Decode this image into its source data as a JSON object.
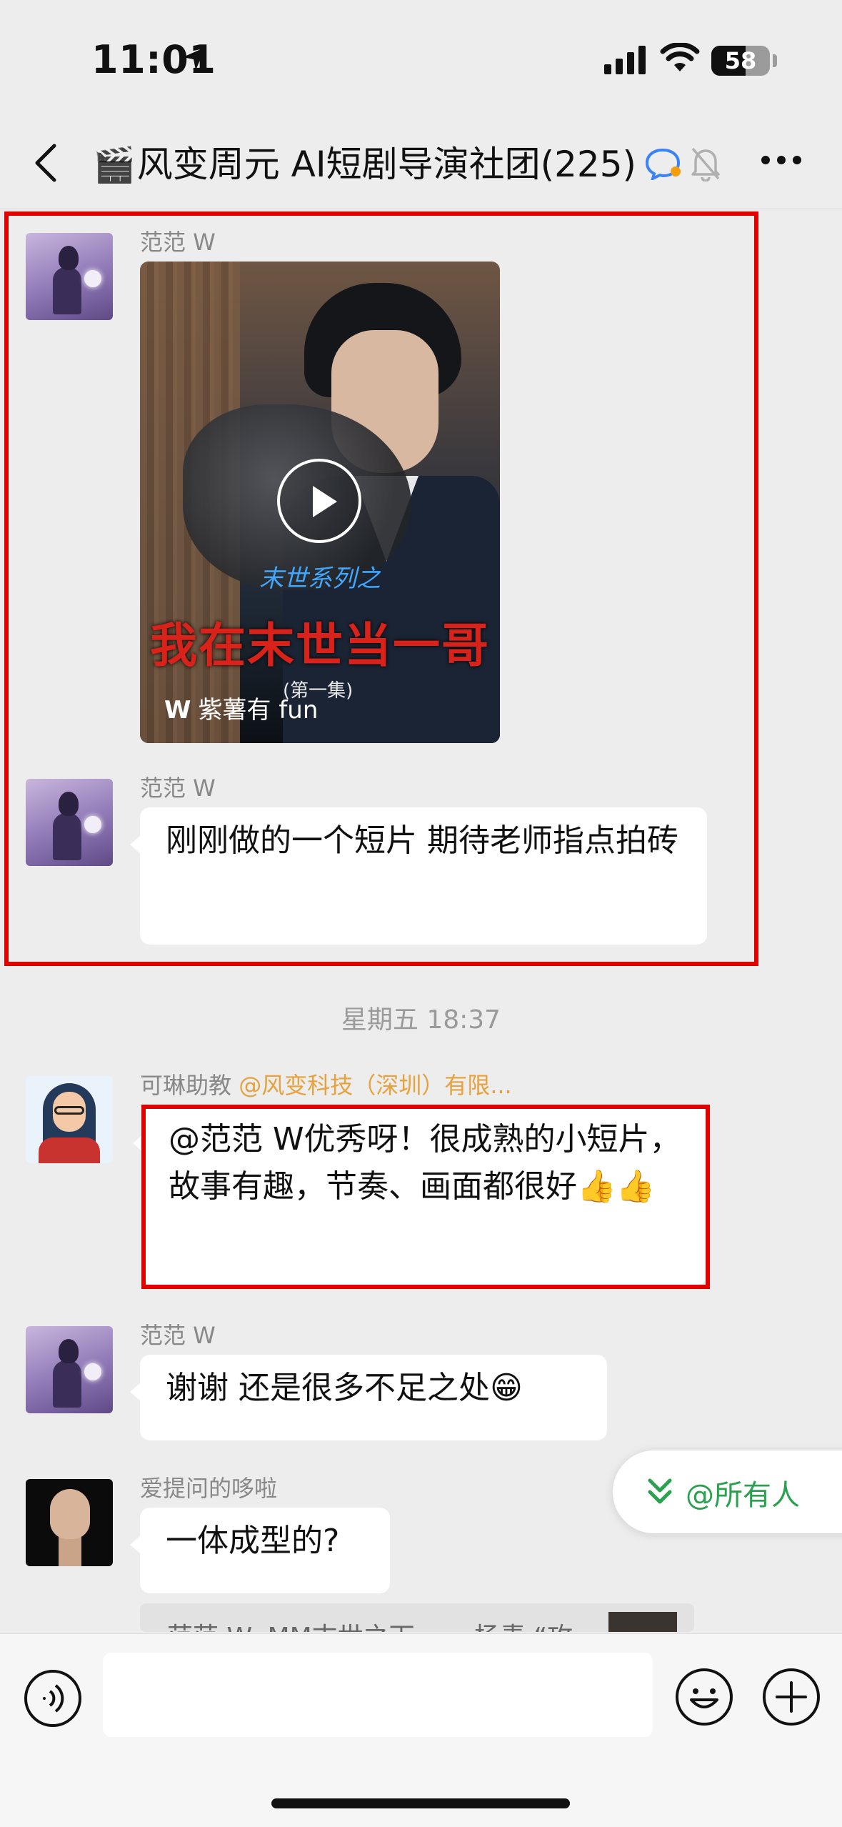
{
  "status_bar": {
    "time": "11:01",
    "battery": "58",
    "battery_level": 0.58
  },
  "nav": {
    "title_emoji": "🎬",
    "title": "风变周元 AI短剧导演社团(225)"
  },
  "messages": {
    "m1": {
      "sender": "范范 W",
      "video": {
        "subtitle": "末世系列之",
        "title": "我在末世当一哥",
        "episode": "(第一集)",
        "watermark_logo": "W",
        "watermark": "紫薯有 fun"
      }
    },
    "m2": {
      "sender": "范范 W",
      "text": "刚刚做的一个短片 期待老师指点拍砖"
    },
    "timestamp": "星期五 18:37",
    "m3": {
      "sender": "可琳助教",
      "sender_tag": "@风变科技（深圳）有限...",
      "text": "@范范 W优秀呀！很成熟的小短片，故事有趣，节奏、画面都很好👍👍"
    },
    "m4": {
      "sender": "范范 W",
      "text": "谢谢 还是很多不足之处😁"
    },
    "m5": {
      "sender": "爱提问的哆啦",
      "text": "一体成型的?",
      "quote": "范范 W: ⅯM末世之下……  杨青 “攻"
    }
  },
  "at_all": {
    "label": "@所有人"
  },
  "colors": {
    "highlight_border": "#e00000",
    "accent_green": "#2aa14f",
    "tag_orange": "#e6a23c"
  }
}
